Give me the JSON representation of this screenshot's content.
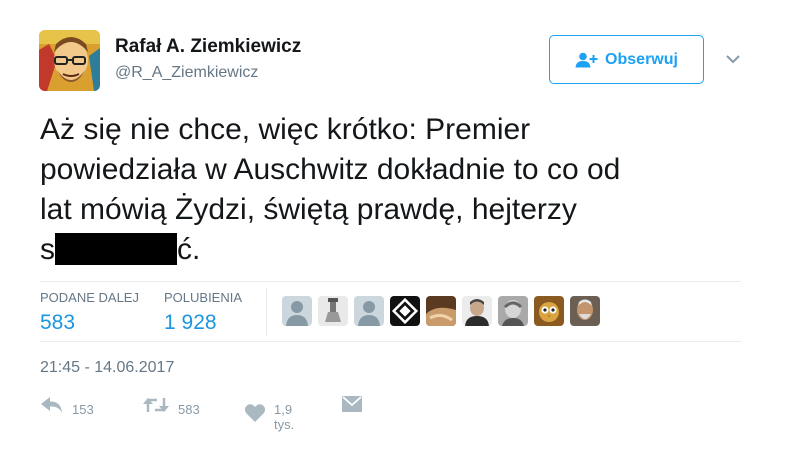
{
  "author": {
    "name": "Rafał A. Ziemkiewicz",
    "handle": "@R_A_Ziemkiewicz"
  },
  "follow_button": {
    "label": "Obserwuj"
  },
  "tweet": {
    "lines": [
      "Aż się nie chce, więc krótko: Premier",
      "powiedziała w Auschwitz dokładnie to co od",
      "lat mówią Żydzi, świętą prawdę, hejterzy"
    ],
    "last_line_prefix": "s",
    "last_line_suffix": "ć."
  },
  "stats": {
    "retweets_label": "PODANE DALEJ",
    "retweets_value": "583",
    "likes_label": "POLUBIENIA",
    "likes_value": "1 928"
  },
  "timestamp": "21:45 - 14.06.2017",
  "actions": {
    "reply_count": "153",
    "retweet_count": "583",
    "like_count": "1,9 tys."
  },
  "colors": {
    "accent": "#1da1f2",
    "link": "#1b95e0",
    "muted": "#657786",
    "icon": "#aab8c2"
  },
  "icons": [
    "add-user-icon",
    "chevron-down-icon",
    "reply-icon",
    "retweet-icon",
    "heart-icon",
    "envelope-icon"
  ]
}
